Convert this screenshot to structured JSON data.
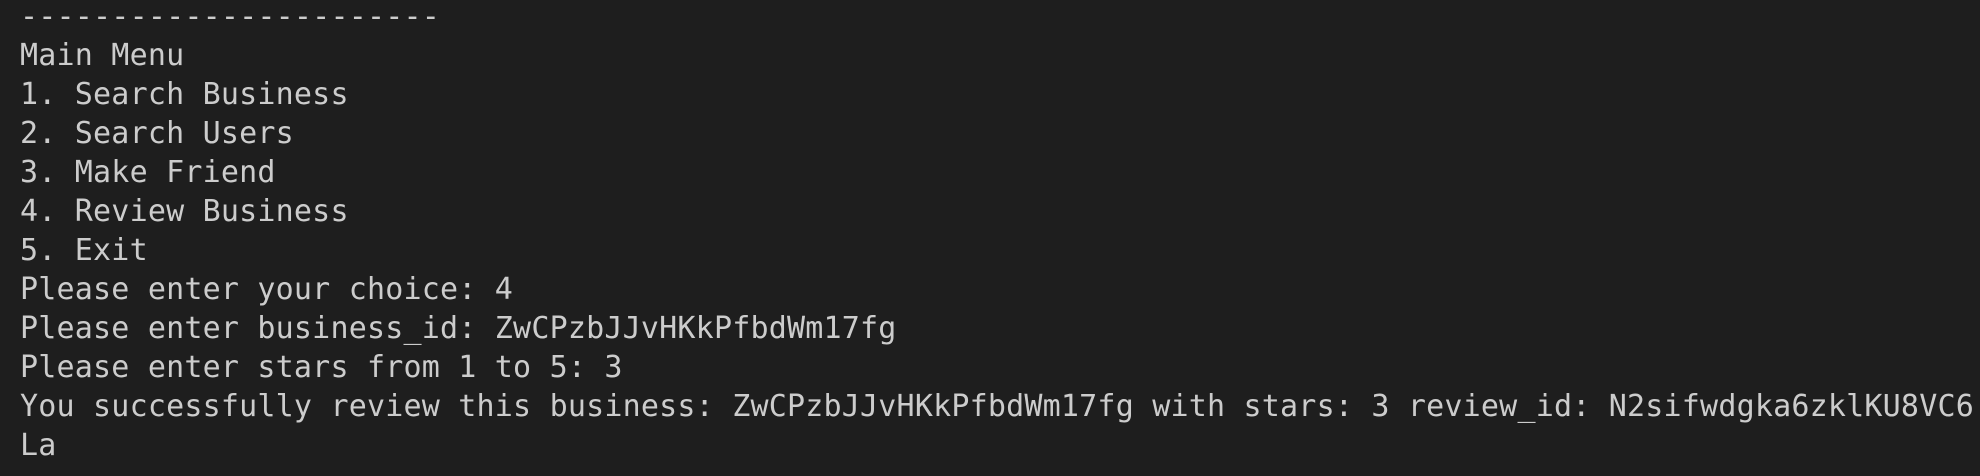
{
  "terminal": {
    "lines": [
      "-----------------------",
      "Main Menu",
      "1. Search Business",
      "2. Search Users",
      "3. Make Friend",
      "4. Review Business",
      "5. Exit",
      "Please enter your choice: 4",
      "Please enter business_id: ZwCPzbJJvHKkPfbdWm17fg",
      "Please enter stars from 1 to 5: 3",
      "You successfully review this business: ZwCPzbJJvHKkPfbdWm17fg with stars: 3 review_id: N2sifwdgka6zklKU8VC6",
      "La"
    ]
  }
}
